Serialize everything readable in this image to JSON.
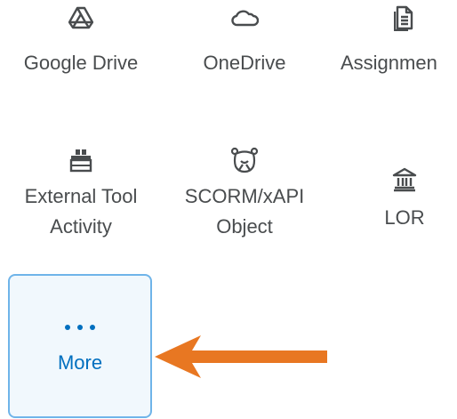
{
  "tiles": [
    {
      "id": "google-drive",
      "label_lines": [
        "Google Drive"
      ],
      "icon": "google-drive-icon"
    },
    {
      "id": "onedrive",
      "label_lines": [
        "OneDrive"
      ],
      "icon": "cloud-icon"
    },
    {
      "id": "assignment",
      "label_lines": [
        "Assignmen"
      ],
      "icon": "assignment-icon"
    },
    {
      "id": "external-tool",
      "label_lines": [
        "External Tool",
        "Activity"
      ],
      "icon": "external-tool-icon"
    },
    {
      "id": "scorm",
      "label_lines": [
        "SCORM/xAPI",
        "Object"
      ],
      "icon": "scorm-icon"
    },
    {
      "id": "lor",
      "label_lines": [
        "LOR"
      ],
      "icon": "institution-icon"
    }
  ],
  "more": {
    "label": "More",
    "icon": "ellipsis-icon"
  },
  "annotation": {
    "icon": "arrow-left-icon",
    "color": "#e87722"
  },
  "colors": {
    "text": "#494c4e",
    "accent": "#006fbf",
    "more_border": "#6fb4e9",
    "more_background": "#f1f8fd"
  }
}
